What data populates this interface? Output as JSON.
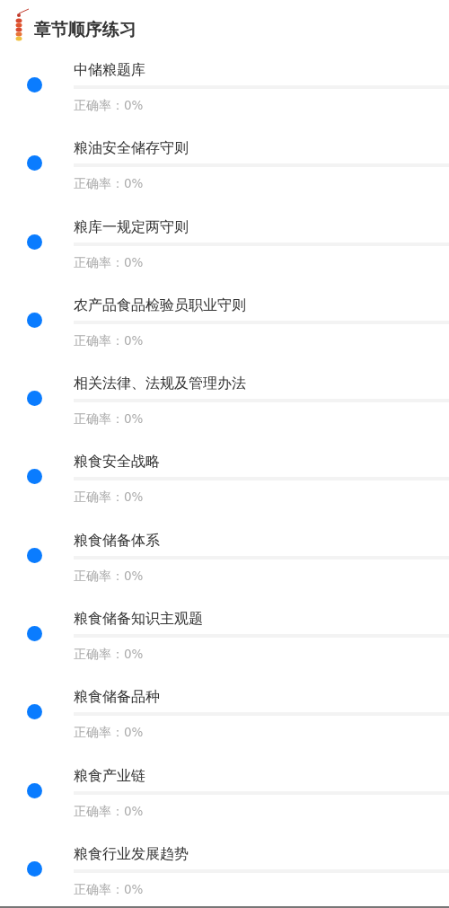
{
  "header": {
    "title": "章节顺序练习"
  },
  "chapters": [
    {
      "name": "中储粮题库",
      "accuracy": "正确率：0%",
      "level": 0
    },
    {
      "name": "粮油安全储存守则",
      "accuracy": "正确率：0%",
      "level": 0
    },
    {
      "name": "粮库一规定两守则",
      "accuracy": "正确率：0%",
      "level": 0
    },
    {
      "name": "农产品食品检验员职业守则",
      "accuracy": "正确率：0%",
      "level": 0
    },
    {
      "name": "相关法律、法规及管理办法",
      "accuracy": "正确率：0%",
      "level": 0
    },
    {
      "name": "粮食安全战略",
      "accuracy": "正确率：0%",
      "level": 0
    },
    {
      "name": "粮食储备体系",
      "accuracy": "正确率：0%",
      "level": 0
    },
    {
      "name": "粮食储备知识主观题",
      "accuracy": "正确率：0%",
      "level": 0
    },
    {
      "name": "粮食储备品种",
      "accuracy": "正确率：0%",
      "level": 0
    },
    {
      "name": "粮食产业链",
      "accuracy": "正确率：0%",
      "level": 0
    },
    {
      "name": "粮食行业发展趋势",
      "accuracy": "正确率：0%",
      "level": 0
    }
  ]
}
